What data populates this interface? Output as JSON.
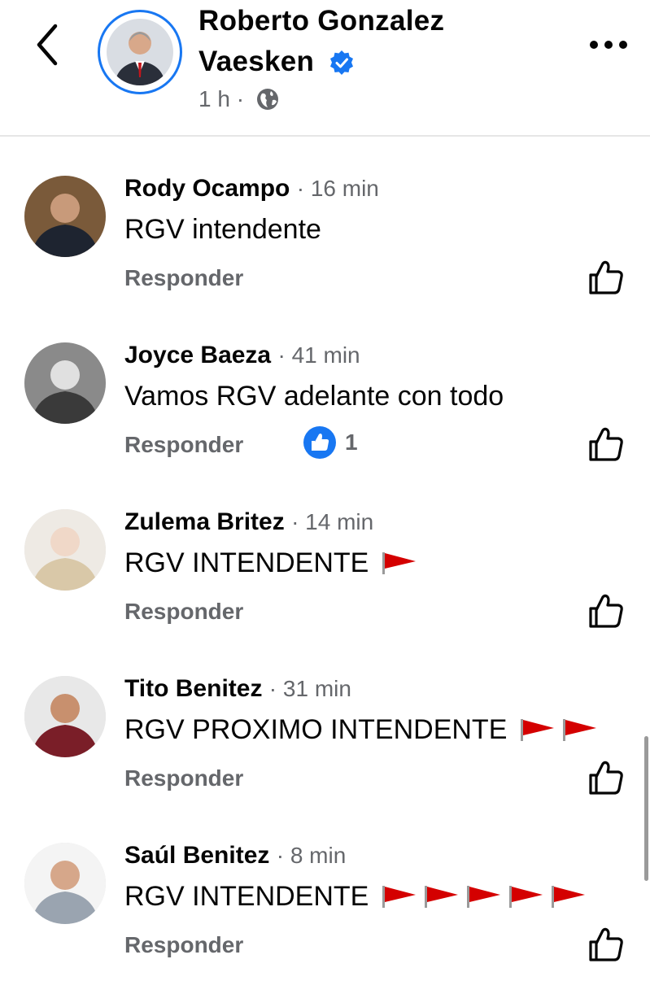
{
  "header": {
    "name_line1": "Roberto Gonzalez",
    "name_line2": "Vaesken",
    "time": "1 h ·",
    "verified": true
  },
  "comments": [
    {
      "name": "Rody Ocampo",
      "time": "· 16 min",
      "text": "RGV intendente",
      "flags": 0,
      "reply_label": "Responder",
      "likes": ""
    },
    {
      "name": "Joyce Baeza",
      "time": "· 41 min",
      "text": "Vamos RGV adelante con todo",
      "flags": 0,
      "reply_label": "Responder",
      "likes": "1"
    },
    {
      "name": "Zulema Britez",
      "time": "· 14 min",
      "text": "RGV INTENDENTE",
      "flags": 1,
      "reply_label": "Responder",
      "likes": ""
    },
    {
      "name": "Tito Benitez",
      "time": "· 31 min",
      "text": "RGV PROXIMO INTENDENTE",
      "flags": 2,
      "reply_label": "Responder",
      "likes": ""
    },
    {
      "name": "Saúl Benitez",
      "time": "· 8 min",
      "text": "RGV INTENDENTE",
      "flags": 5,
      "reply_label": "Responder",
      "likes": ""
    }
  ],
  "colors": {
    "accent": "#1877f2",
    "flag": "#d40000",
    "muted": "#65676b"
  }
}
